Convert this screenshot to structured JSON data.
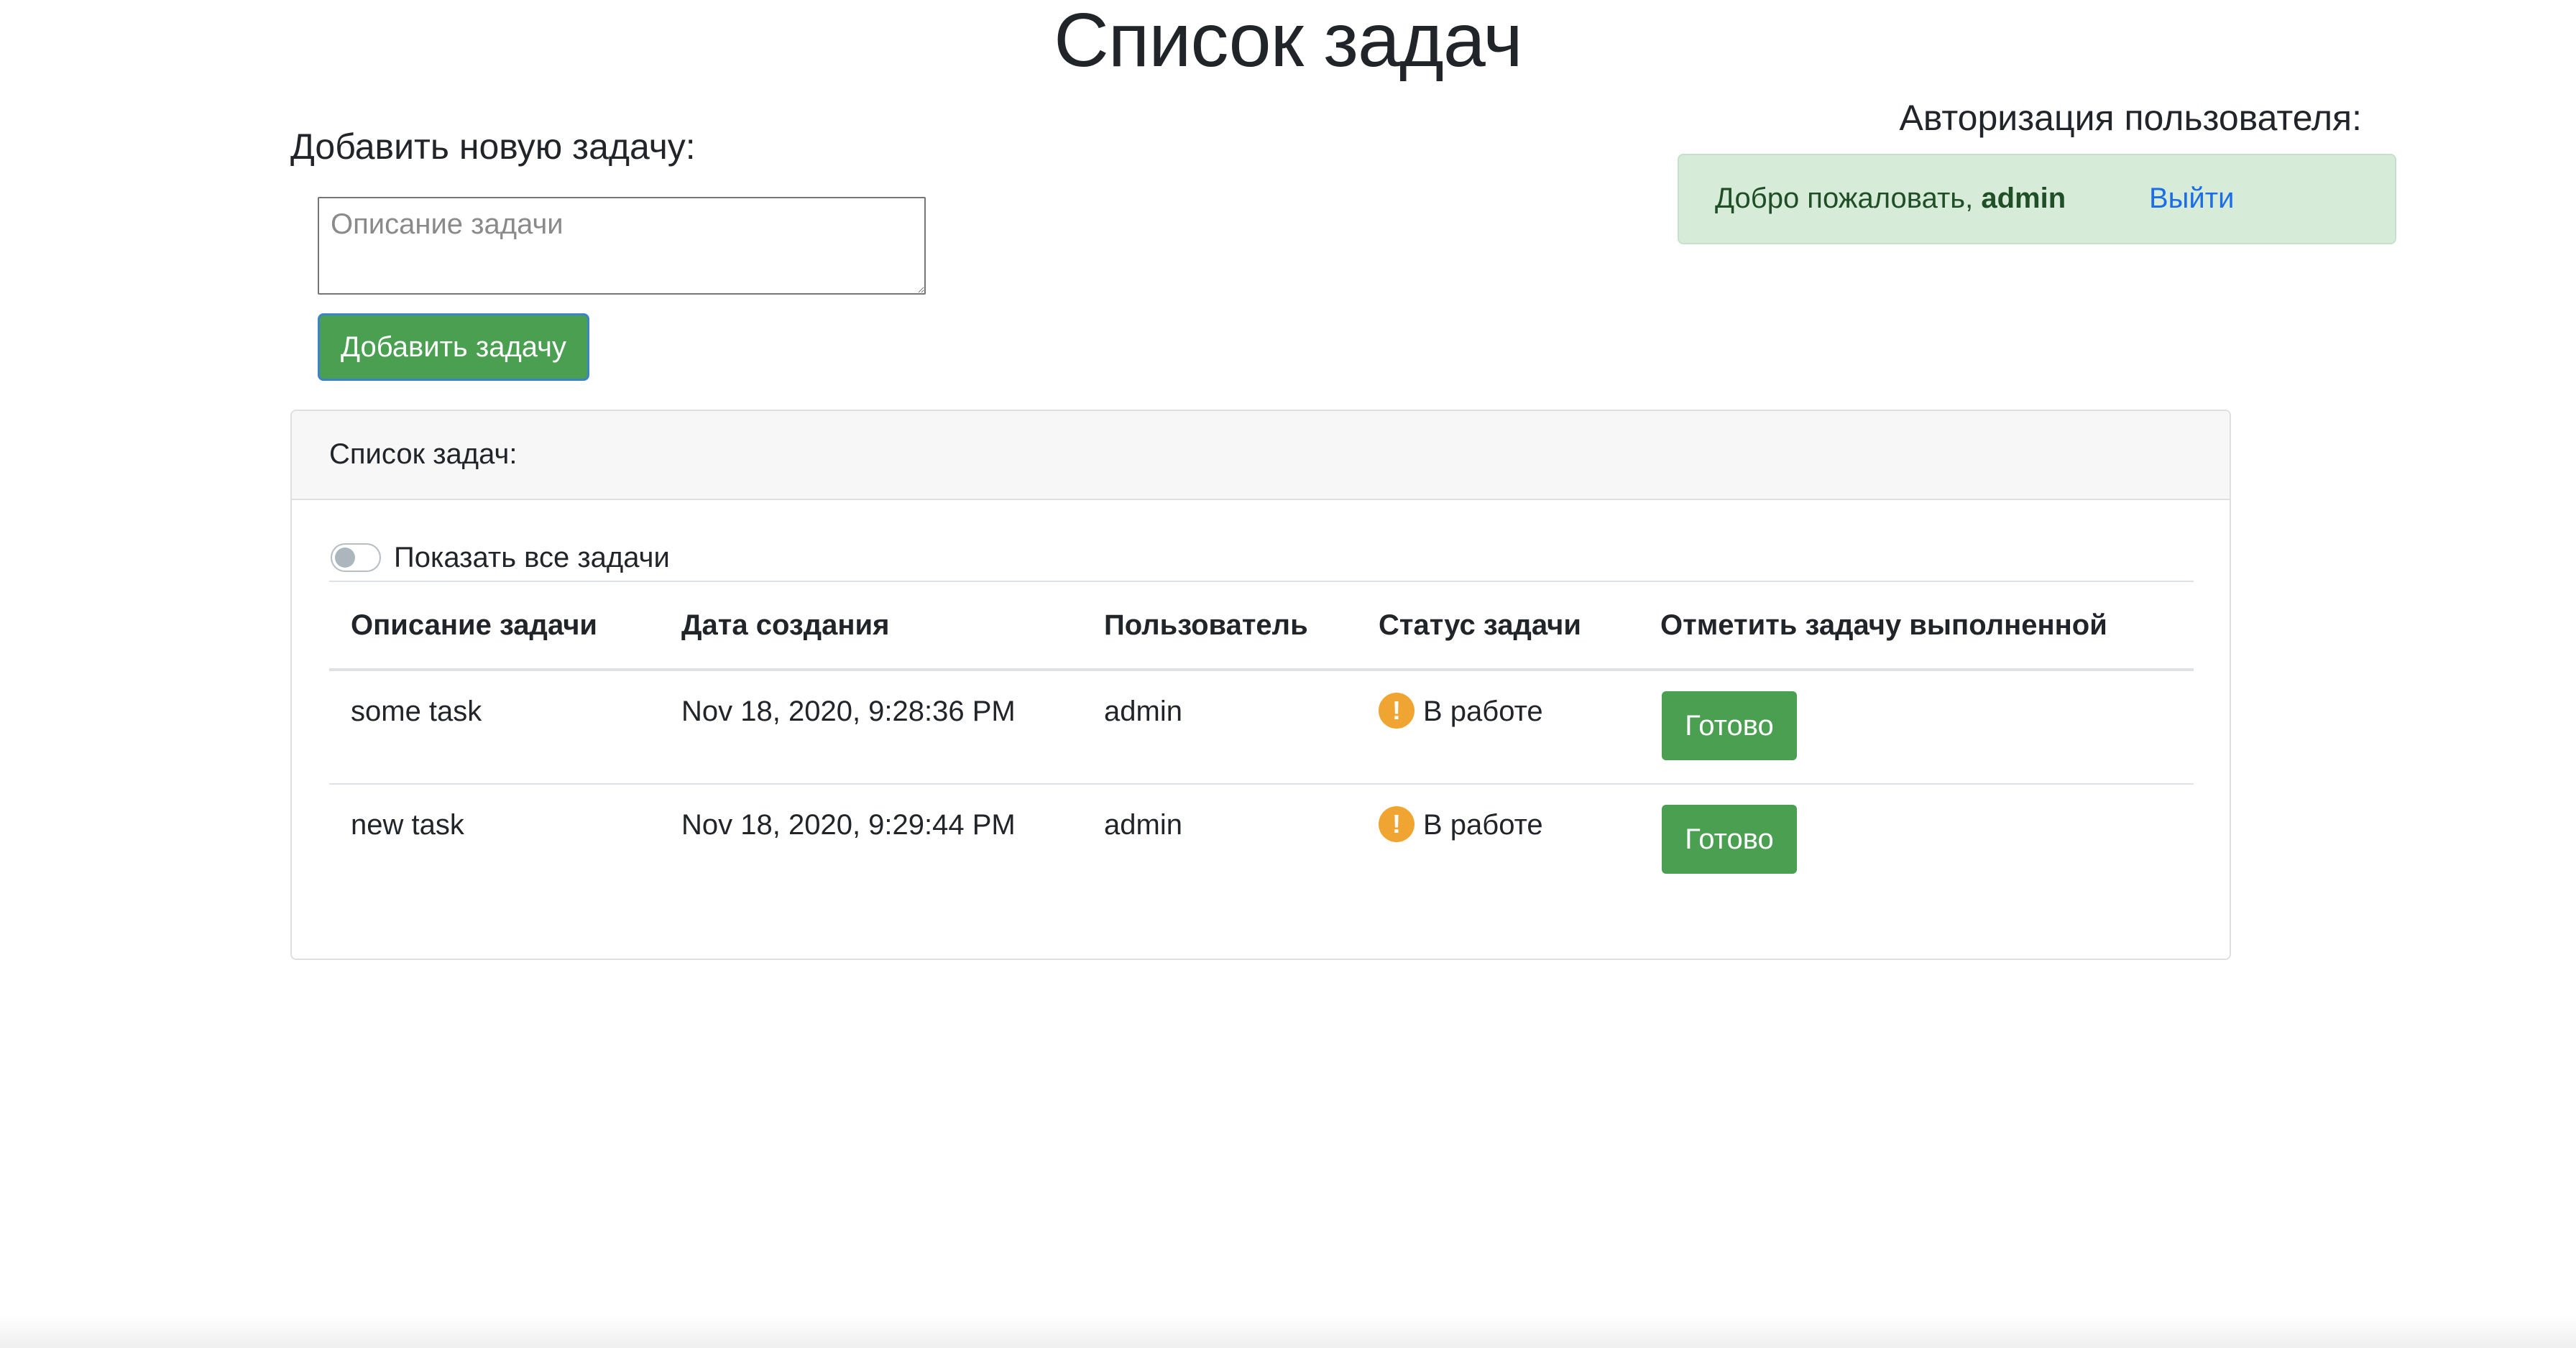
{
  "page_title": "Список задач",
  "add_task": {
    "heading": "Добавить новую задачу:",
    "textarea_value": "",
    "textarea_placeholder": "Описание задачи",
    "button_label": "Добавить задачу"
  },
  "auth": {
    "heading": "Авторизация пользователя:",
    "welcome_prefix": "Добро пожаловать,",
    "username": "admin",
    "logout_label": "Выйти"
  },
  "tasks_card": {
    "header_label": "Список задач:",
    "toggle_label": "Показать все задачи",
    "toggle_checked": false,
    "columns": [
      "Описание задачи",
      "Дата создания",
      "Пользователь",
      "Статус задачи",
      "Отметить задачу выполненной"
    ],
    "rows": [
      {
        "description": "some task",
        "created": "Nov 18, 2020, 9:28:36 PM",
        "user": "admin",
        "status_icon": "exclamation-circle-icon",
        "status": "В работе",
        "action_label": "Готово"
      },
      {
        "description": "new task",
        "created": "Nov 18, 2020, 9:29:44 PM",
        "user": "admin",
        "status_icon": "exclamation-circle-icon",
        "status": "В работе",
        "action_label": "Готово"
      }
    ]
  },
  "colors": {
    "primary_green": "#4a9f51",
    "alert_background": "#d6ebd8",
    "link_blue": "#1b6ee8",
    "warning_orange": "#f0a533"
  }
}
